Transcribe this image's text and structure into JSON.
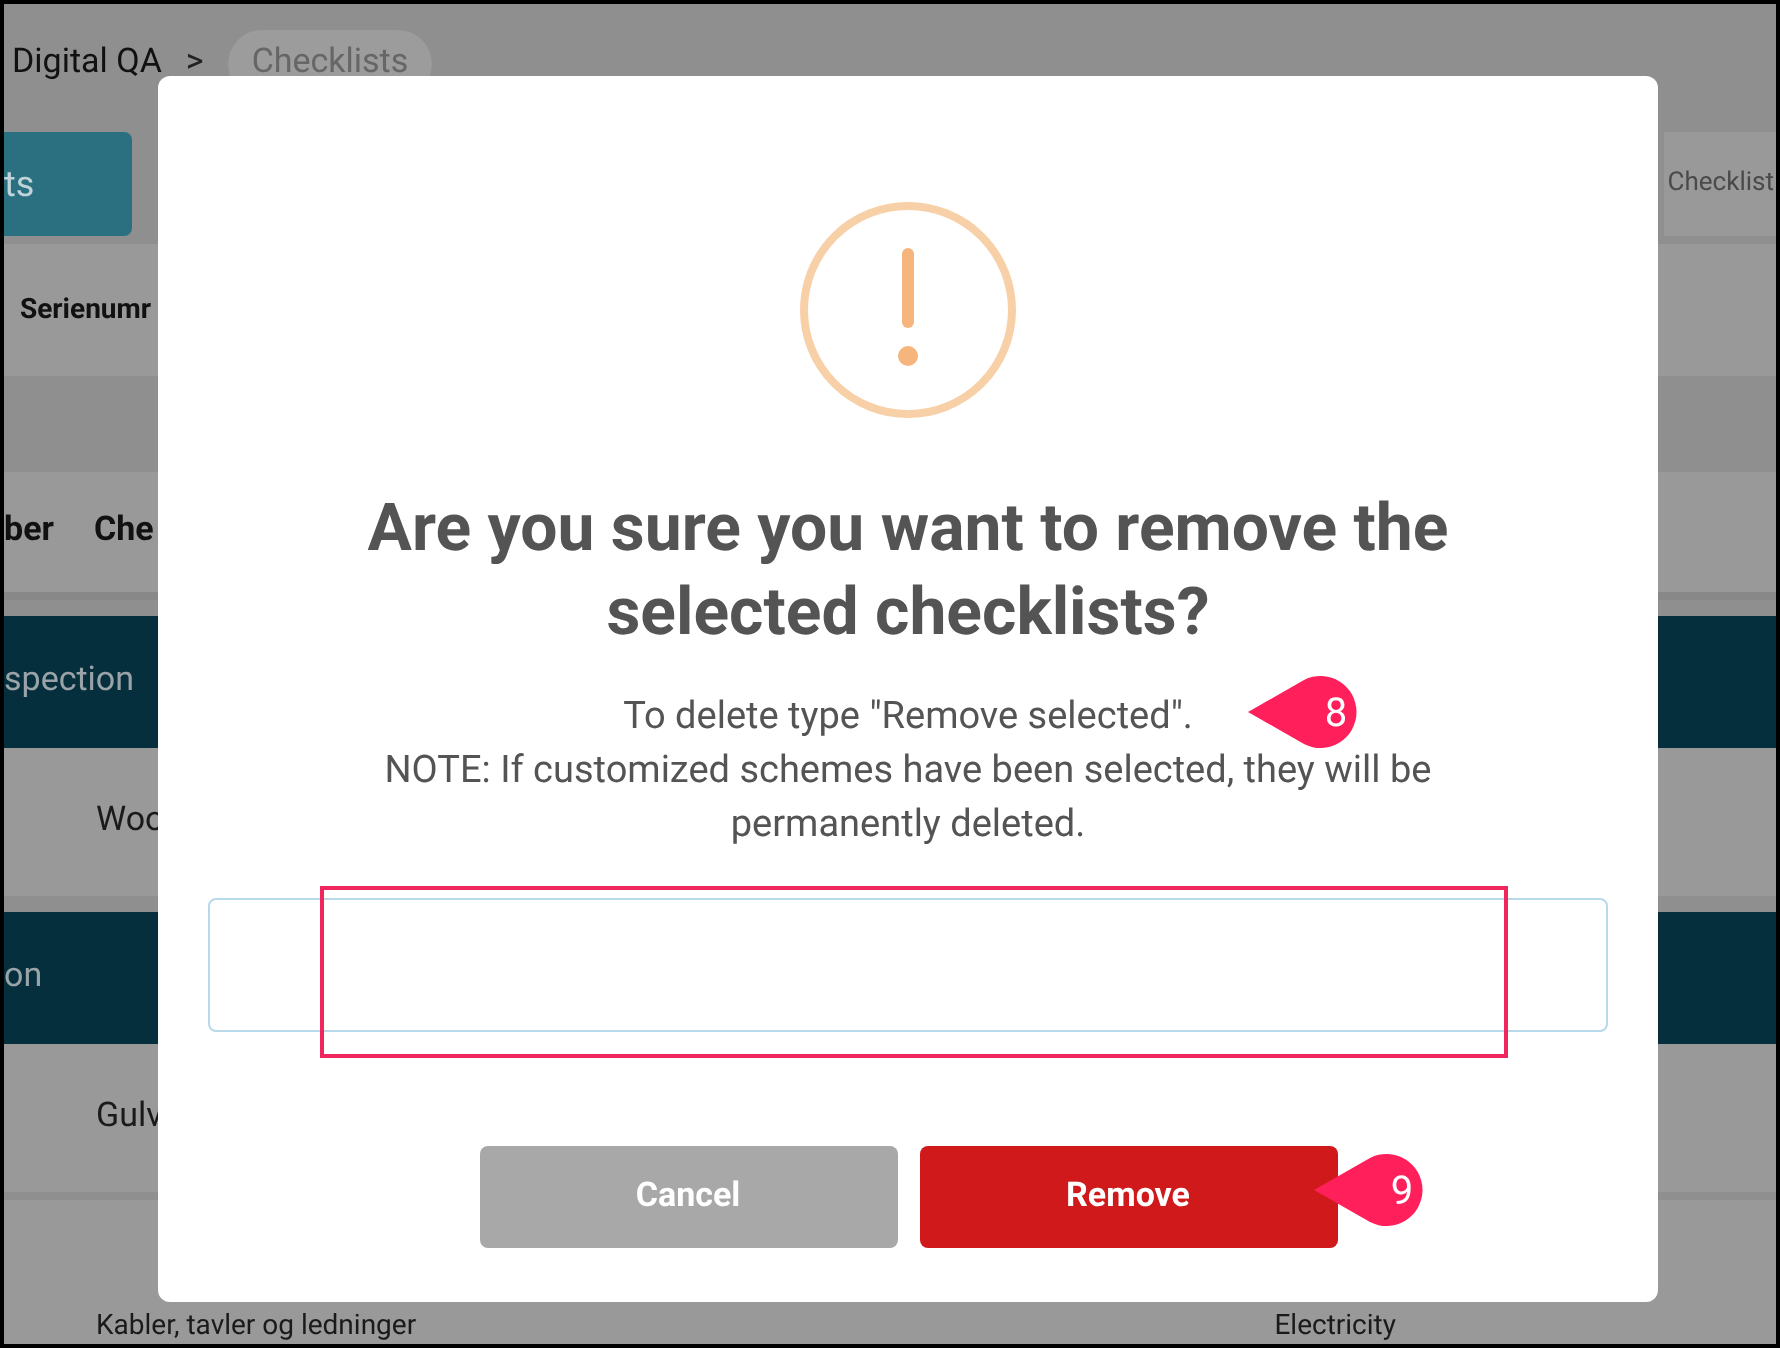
{
  "breadcrumb": {
    "items": [
      "Digital QA",
      "Checklists"
    ],
    "separator": ">"
  },
  "toolbar": {
    "left_button": "ts",
    "right_tab": "Checklist"
  },
  "filter_label": "Serienumr",
  "table": {
    "columns": [
      "ber",
      "Che"
    ],
    "groups": [
      {
        "title": "spection",
        "items": [
          {
            "name": "Woo"
          }
        ]
      },
      {
        "title": "on",
        "items": [
          {
            "name": "Gulv"
          },
          {
            "name": "Kabler, tavler og ledninger",
            "category": "Electricity"
          }
        ]
      }
    ]
  },
  "dialog": {
    "title": "Are you sure you want to remove the selected checklists?",
    "message": [
      "To delete type \"Remove selected\".",
      "NOTE: If customized schemes have been selected, they will be permanently deleted."
    ],
    "buttons": [
      {
        "label": "Cancel",
        "kind": "cancel"
      },
      {
        "label": "Remove",
        "kind": "danger"
      }
    ]
  },
  "callouts": [
    "8",
    "9"
  ]
}
